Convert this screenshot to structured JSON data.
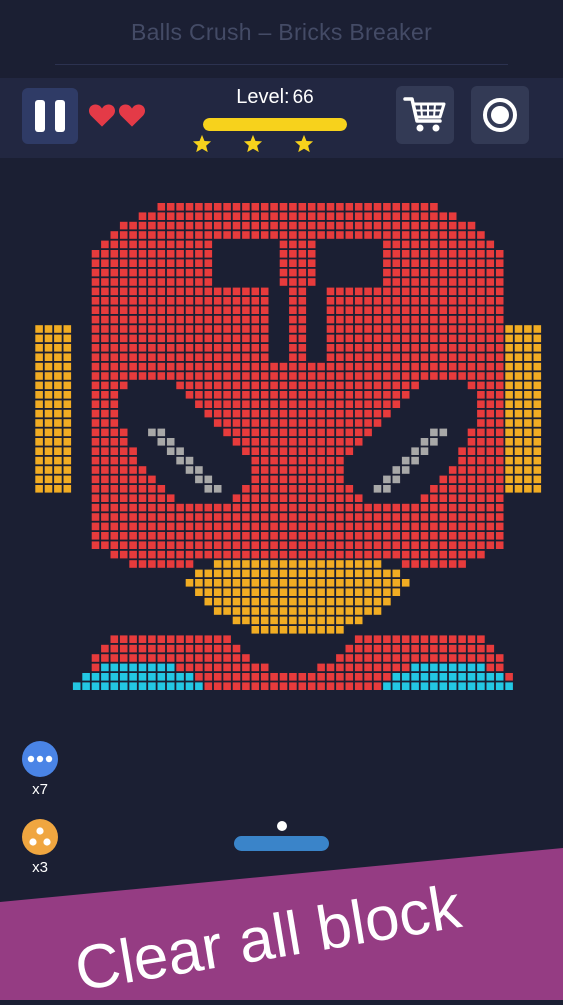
{
  "app": {
    "title": "Balls Crush – Bricks Breaker"
  },
  "hud": {
    "level_label": "Level:",
    "level_value": "66",
    "level_progress": 1.0,
    "lives": 2,
    "stars_earned": 3,
    "icons": {
      "pause": "pause-icon",
      "life": "heart-icon",
      "shop": "shopping-cart-icon",
      "target": "target-icon",
      "star": "star-icon"
    }
  },
  "powerups": [
    {
      "name": "multi-ball",
      "icon": "three-dots-icon",
      "count": "x7",
      "color": "#4a84e6"
    },
    {
      "name": "split-ball",
      "icon": "triple-ball-icon",
      "count": "x3",
      "color": "#f0a640"
    }
  ],
  "banner": {
    "text": "Clear all block",
    "color": "#953c83"
  },
  "colors": {
    "background": "#1b1f33",
    "hud": "#222741",
    "brick_red": "#e73b3c",
    "brick_yellow": "#f1ac23",
    "brick_gray": "#a8a8a8",
    "brick_cyan": "#23c7e3",
    "paddle": "#3a84c9",
    "level_bar": "#f7d21c"
  },
  "bricks_picture": "red masked head with cross on forehead, gray slanted eyes, yellow mouth, yellow side panels, cyan shoulders"
}
